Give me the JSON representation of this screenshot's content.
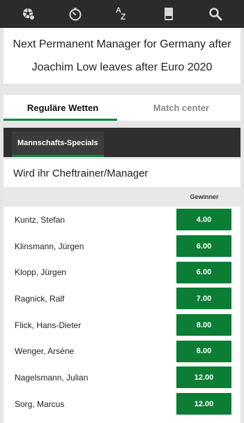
{
  "topbar": {
    "icons": [
      "sports-ball-icon",
      "stopwatch-icon",
      "az-sort-icon",
      "betslip-icon",
      "search-icon"
    ],
    "az_a": "A",
    "az_z": "Z"
  },
  "event": {
    "title": "Next Permanent Manager for Germany after Joachim Low leaves after Euro 2020"
  },
  "tabs": [
    {
      "label": "Reguläre Wetten",
      "active": true
    },
    {
      "label": "Match center",
      "active": false
    }
  ],
  "section": {
    "label": "Mannschafts-Specials"
  },
  "market": {
    "title": "Wird ihr Cheftrainer/Manager",
    "column_header": "Gewinner",
    "rows": [
      {
        "name": "Kuntz, Stefan",
        "odds": "4.00"
      },
      {
        "name": "Klinsmann, Jürgen",
        "odds": "6.00"
      },
      {
        "name": "Klopp, Jürgen",
        "odds": "6.00"
      },
      {
        "name": "Ragnick, Ralf",
        "odds": "7.00"
      },
      {
        "name": "Flick, Hans-Dieter",
        "odds": "8.00"
      },
      {
        "name": "Wenger, Arséne",
        "odds": "8.00"
      },
      {
        "name": "Nagelsmann, Julian",
        "odds": "12.00"
      },
      {
        "name": "Sorg, Marcus",
        "odds": "12.00"
      }
    ]
  },
  "colors": {
    "accent": "#0b8a3f",
    "odds_button": "#0b7d35",
    "topbar": "#2b2b2b"
  }
}
